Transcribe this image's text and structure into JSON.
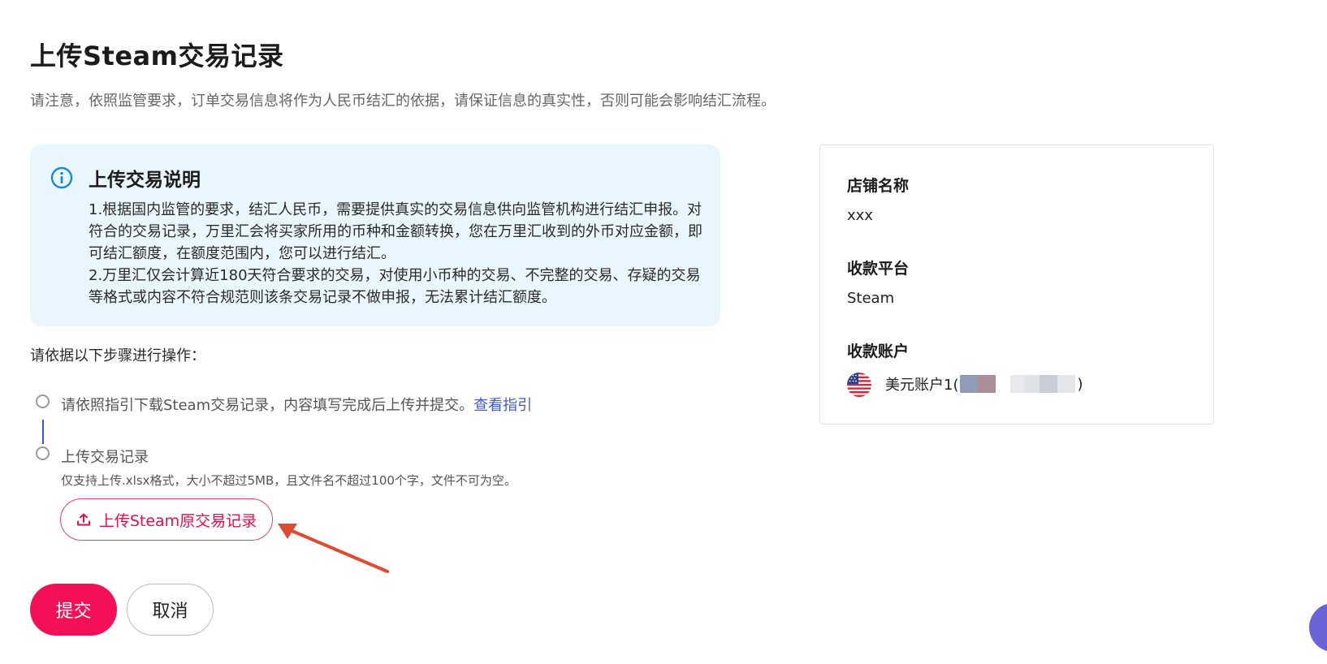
{
  "page": {
    "title": "上传Steam交易记录",
    "subtitle": "请注意，依照监管要求，订单交易信息将作为人民币结汇的依据，请保证信息的真实性，否则可能会影响结汇流程。"
  },
  "info_box": {
    "icon": "info-icon",
    "title": "上传交易说明",
    "paragraphs": [
      "1.根据国内监管的要求，结汇人民币，需要提供真实的交易信息供向监管机构进行结汇申报。对符合的交易记录，万里汇会将买家所用的币种和金额转换，您在万里汇收到的外币对应金额，即可结汇额度，在额度范围内，您可以进行结汇。",
      "2.万里汇仅会计算近180天符合要求的交易，对使用小币种的交易、不完整的交易、存疑的交易等格式或内容不符合规范则该条交易记录不做申报，无法累计结汇额度。"
    ]
  },
  "steps": {
    "heading": "请依据以下步骤进行操作：",
    "step1": {
      "text": "请依照指引下载Steam交易记录，内容填写完成后上传并提交。",
      "link": "查看指引"
    },
    "step2": {
      "title": "上传交易记录",
      "hint": "仅支持上传.xlsx格式，大小不超过5MB，且文件名不超过100个字，文件不可为空。",
      "upload_label": "上传Steam原交易记录",
      "upload_icon": "upload-icon"
    }
  },
  "actions": {
    "submit_label": "提交",
    "cancel_label": "取消"
  },
  "side_card": {
    "store_name_label": "店铺名称",
    "store_name_value": "xxx",
    "platform_label": "收款平台",
    "platform_value": "Steam",
    "account_label": "收款账户",
    "account_prefix": "美元账户1(",
    "account_suffix": ")",
    "account_flag": "us-flag-icon"
  },
  "colors": {
    "accent": "#f50f56",
    "link": "#3f5ad1",
    "info_bg": "#eaf6fd",
    "info_icon": "#1a8ad4",
    "annotation_arrow": "#e04a30"
  }
}
